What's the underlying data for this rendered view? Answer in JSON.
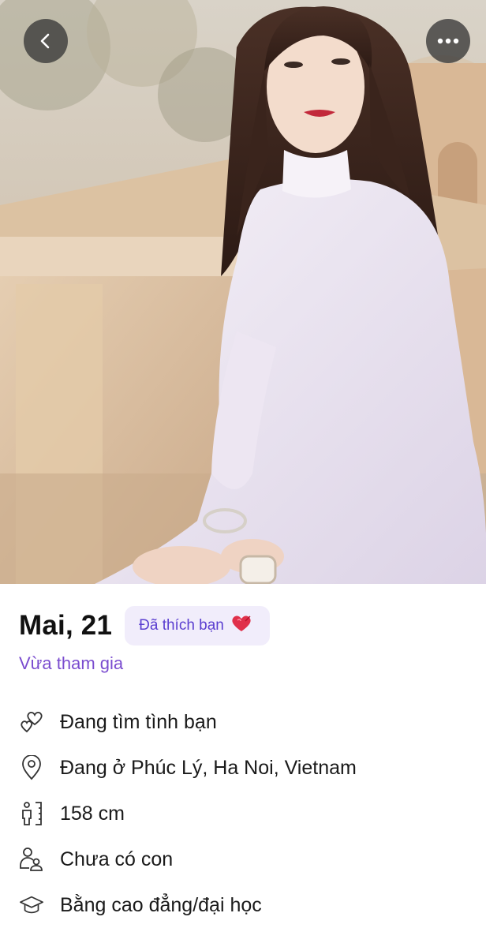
{
  "profile": {
    "name_age": "Mai, 21",
    "liked_badge": "Đã thích bạn",
    "joined_status": "Vừa tham gia",
    "details": [
      {
        "icon": "hearts-icon",
        "text": "Đang tìm tình bạn"
      },
      {
        "icon": "location-pin-icon",
        "text": "Đang ở Phúc Lý, Ha Noi, Vietnam"
      },
      {
        "icon": "height-icon",
        "text": "158 cm"
      },
      {
        "icon": "family-icon",
        "text": "Chưa có con"
      },
      {
        "icon": "graduation-cap-icon",
        "text": "Bằng cao đẳng/đại học"
      }
    ]
  },
  "top_bar": {
    "back_icon": "chevron-left-icon",
    "more_icon": "ellipsis-icon"
  },
  "colors": {
    "accent_purple": "#7a4ccf",
    "badge_bg": "#f1edfb",
    "badge_text": "#5b3fd0",
    "heart_red": "#e0304a"
  }
}
